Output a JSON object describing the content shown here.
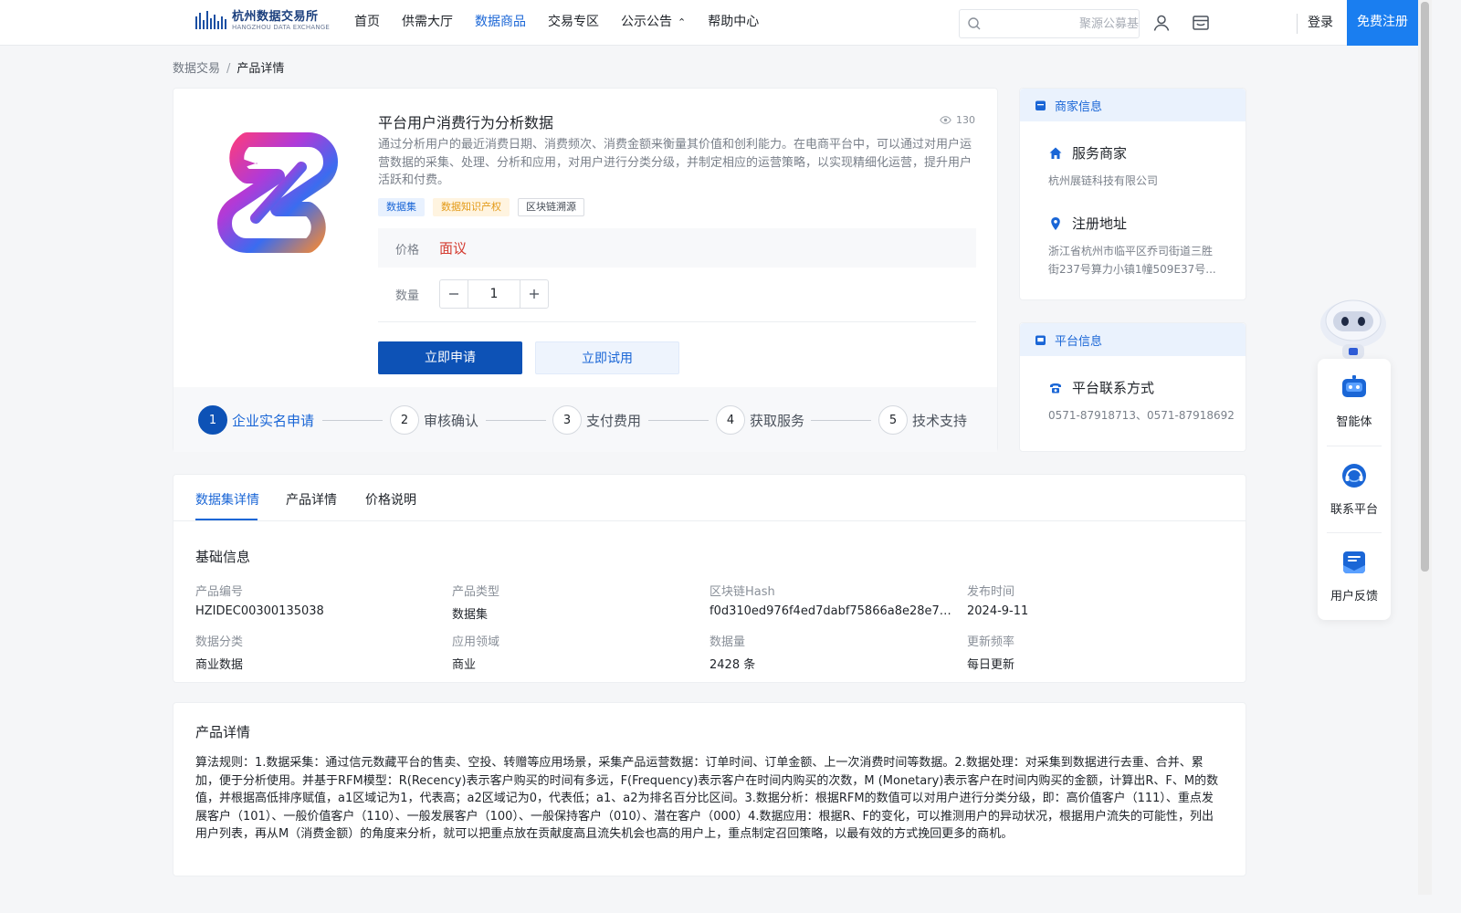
{
  "header": {
    "logo_cn": "杭州数据交易所",
    "logo_en": "HANGZHOU DATA EXCHANGE",
    "nav": [
      {
        "label": "首页",
        "active": false
      },
      {
        "label": "供需大厅",
        "active": false
      },
      {
        "label": "数据商品",
        "active": true
      },
      {
        "label": "交易专区",
        "active": false
      },
      {
        "label": "公示公告",
        "active": false
      },
      {
        "label": "帮助中心",
        "active": false
      }
    ],
    "search_placeholder": "聚源公募基",
    "login": "登录",
    "register": "免费注册"
  },
  "breadcrumb": {
    "root": "数据交易",
    "sep": "/",
    "current": "产品详情"
  },
  "product": {
    "title": "平台用户消费行为分析数据",
    "views": "130",
    "description": "通过分析用户的最近消费日期、消费频次、消费金额来衡量其价值和创利能力。在电商平台中，可以通过对用户运营数据的采集、处理、分析和应用，对用户进行分类分级，并制定相应的运营策略，以实现精细化运营，提升用户活跃和付费。",
    "tags": [
      "数据集",
      "数据知识产权",
      "区块链溯源"
    ],
    "price_label": "价格",
    "price_value": "面议",
    "qty_label": "数量",
    "qty_value": "1",
    "apply_button": "立即申请",
    "try_button": "立即试用",
    "steps": [
      {
        "num": "1",
        "label": "企业实名申请"
      },
      {
        "num": "2",
        "label": "审核确认"
      },
      {
        "num": "3",
        "label": "支付费用"
      },
      {
        "num": "4",
        "label": "获取服务"
      },
      {
        "num": "5",
        "label": "技术支持"
      }
    ]
  },
  "merchant": {
    "header": "商家信息",
    "service_label": "服务商家",
    "service_value": "杭州展链科技有限公司",
    "address_label": "注册地址",
    "address_value": "浙江省杭州市临平区乔司街道三胜街237号算力小镇1幢509E37号..."
  },
  "platform": {
    "header": "平台信息",
    "contact_label": "平台联系方式",
    "contact_value": "0571-87918713、0571-87918692"
  },
  "float_tools": [
    "智能体",
    "联系平台",
    "用户反馈"
  ],
  "tabs": [
    "数据集详情",
    "产品详情",
    "价格说明"
  ],
  "basic": {
    "title": "基础信息",
    "fields": [
      {
        "k": "产品编号",
        "v": "HZIDEC00300135038"
      },
      {
        "k": "产品类型",
        "v": "数据集"
      },
      {
        "k": "区块链Hash",
        "v": "f0d310ed976f4ed7dabf75866a8e28e7b6d..."
      },
      {
        "k": "发布时间",
        "v": "2024-9-11"
      },
      {
        "k": "数据分类",
        "v": "商业数据"
      },
      {
        "k": "应用领域",
        "v": "商业"
      },
      {
        "k": "数据量",
        "v": "2428 条"
      },
      {
        "k": "更新频率",
        "v": "每日更新"
      }
    ]
  },
  "product_detail": {
    "title": "产品详情",
    "text": "算法规则：1.数据采集：通过信元数藏平台的售卖、空投、转赠等应用场景，采集产品运营数据：订单时间、订单金额、上一次消费时间等数据。2.数据处理：对采集到数据进行去重、合并、累加，便于分析使用。并基于RFM模型：R(Recency)表示客户购买的时间有多远，F(Frequency)表示客户在时间内购买的次数，M (Monetary)表示客户在时间内购买的金额，计算出R、F、M的数值，并根据高低排序赋值，a1区域记为1，代表高；a2区域记为0，代表低；a1、a2为排名百分比区间。3.数据分析：根据RFM的数值可以对用户进行分类分级，即：高价值客户（111）、重点发展客户（101）、一般价值客户（110）、一般发展客户（100）、一般保持客户（010）、潜在客户（000）4.数据应用：根据R、F的变化，可以推测用户的异动状况，根据用户流失的可能性，列出用户列表，再从M（消费金额）的角度来分析，就可以把重点放在贡献度高且流失机会也高的用户上，重点制定召回策略，以最有效的方式挽回更多的商机。"
  }
}
